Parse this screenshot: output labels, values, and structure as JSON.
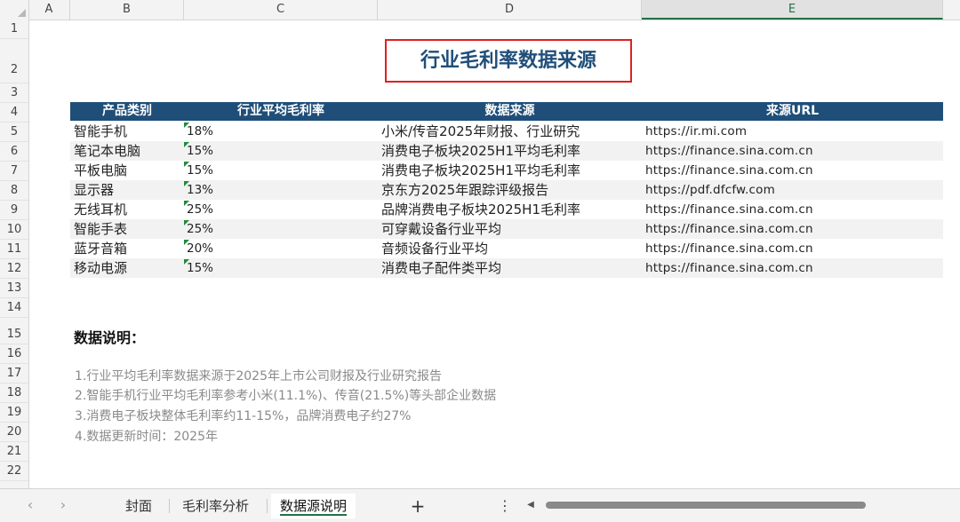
{
  "columns": [
    "A",
    "B",
    "C",
    "D",
    "E"
  ],
  "rows": [
    "1",
    "2",
    "3",
    "4",
    "5",
    "6",
    "7",
    "8",
    "9",
    "10",
    "11",
    "12",
    "13",
    "14",
    "15",
    "16",
    "17",
    "18",
    "19",
    "20",
    "21",
    "22"
  ],
  "title": "行业毛利率数据来源",
  "table": {
    "headers": [
      "产品类别",
      "行业平均毛利率",
      "数据来源",
      "来源URL"
    ],
    "rows": [
      {
        "category": "智能手机",
        "margin": "18%",
        "source": "小米/传音2025年财报、行业研究",
        "url": "https://ir.mi.com"
      },
      {
        "category": "笔记本电脑",
        "margin": "15%",
        "source": "消费电子板块2025H1平均毛利率",
        "url": "https://finance.sina.com.cn"
      },
      {
        "category": "平板电脑",
        "margin": "15%",
        "source": "消费电子板块2025H1平均毛利率",
        "url": "https://finance.sina.com.cn"
      },
      {
        "category": "显示器",
        "margin": "13%",
        "source": "京东方2025年跟踪评级报告",
        "url": "https://pdf.dfcfw.com"
      },
      {
        "category": "无线耳机",
        "margin": "25%",
        "source": "品牌消费电子板块2025H1毛利率",
        "url": "https://finance.sina.com.cn"
      },
      {
        "category": "智能手表",
        "margin": "25%",
        "source": "可穿戴设备行业平均",
        "url": "https://finance.sina.com.cn"
      },
      {
        "category": "蓝牙音箱",
        "margin": "20%",
        "source": "音频设备行业平均",
        "url": "https://finance.sina.com.cn"
      },
      {
        "category": "移动电源",
        "margin": "15%",
        "source": "消费电子配件类平均",
        "url": "https://finance.sina.com.cn"
      }
    ]
  },
  "notes": {
    "title": "数据说明：",
    "items": [
      "1.行业平均毛利率数据来源于2025年上市公司财报及行业研究报告",
      "2.智能手机行业平均毛利率参考小米(11.1%)、传音(21.5%)等头部企业数据",
      "3.消费电子板块整体毛利率约11-15%，品牌消费电子约27%",
      "4.数据更新时间：2025年"
    ]
  },
  "sheet_tabs": [
    {
      "label": "封面",
      "active": false
    },
    {
      "label": "毛利率分析",
      "active": false
    },
    {
      "label": "数据源说明",
      "active": true
    }
  ],
  "tabbar": {
    "prev_icon": "‹",
    "next_icon": "›",
    "add_icon": "+",
    "more_icon": "⋮",
    "scroll_left_icon": "◀"
  },
  "colors": {
    "header_fill": "#1f4e79",
    "title_border": "#e02020",
    "accent": "#217346"
  }
}
